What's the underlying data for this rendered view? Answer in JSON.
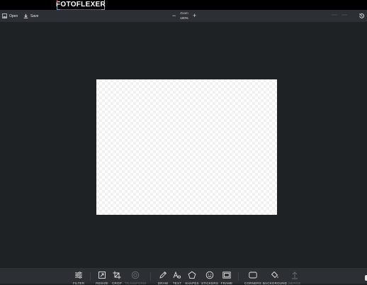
{
  "header": {
    "logo_text": "FOTOFLEXER"
  },
  "toolbar": {
    "open_label": "Open",
    "save_label": "Save",
    "zoom_label": "Zoom",
    "zoom_value": "100%"
  },
  "tools": [
    {
      "label": "FILTER"
    },
    {
      "label": "RESIZE"
    },
    {
      "label": "CROP"
    },
    {
      "label": "TRANSFORM"
    },
    {
      "label": "DRAW"
    },
    {
      "label": "TEXT"
    },
    {
      "label": "SHAPES"
    },
    {
      "label": "STICKERS"
    },
    {
      "label": "FRAME"
    },
    {
      "label": "CORNERS"
    },
    {
      "label": "BACKGROUND"
    },
    {
      "label": "MERGE"
    }
  ]
}
